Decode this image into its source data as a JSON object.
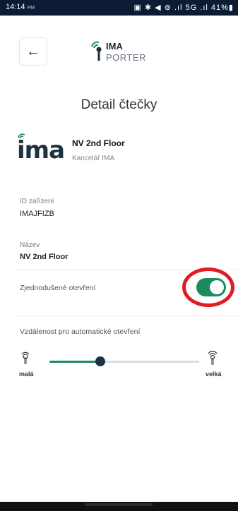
{
  "status_bar": {
    "time": "14:14",
    "small_text": "PM",
    "icons_text": "▣ ✱ ◀ ⊚ .ıl 5G .ıl 41%▮"
  },
  "header": {
    "back_icon": "arrow-left-icon",
    "logo_top": "IMA",
    "logo_bottom": "PORTER"
  },
  "page": {
    "title": "Detail čtečky"
  },
  "device": {
    "brand": "ima",
    "name": "NV 2nd Floor",
    "location": "Kancelář IMA"
  },
  "fields": {
    "id_label": "ID zařízení",
    "id_value": "IMAJFIZB",
    "name_label": "Název",
    "name_value": "NV 2nd Floor"
  },
  "simple_open": {
    "label": "Zjednodušené otevření",
    "enabled": true,
    "color_on": "#1c8a5c"
  },
  "auto_open": {
    "label": "Vzdálenost pro automatické otevření",
    "min_label": "malá",
    "max_label": "velká",
    "level": 0.34
  },
  "annotation_color": "#e11b22"
}
